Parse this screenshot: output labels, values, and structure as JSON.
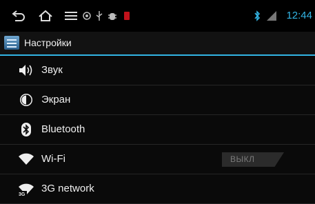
{
  "status_bar": {
    "nav_icons": [
      "back-icon",
      "home-icon",
      "recent-apps-icon"
    ],
    "notification_icons": [
      "gps-icon",
      "usb-icon",
      "debug-icon",
      "warning-icon"
    ],
    "indicators": [
      "bluetooth-icon",
      "signal-icon"
    ],
    "time": "12:44",
    "accent_color": "#33b5e5"
  },
  "header": {
    "icon": "settings-app-icon",
    "title": "Настройки"
  },
  "settings": {
    "items": [
      {
        "label": "Звук",
        "icon": "sound-icon"
      },
      {
        "label": "Экран",
        "icon": "display-icon"
      },
      {
        "label": "Bluetooth",
        "icon": "bluetooth-icon"
      },
      {
        "label": "Wi-Fi",
        "icon": "wifi-icon",
        "toggle": "ВЫКЛ"
      },
      {
        "label": "3G network",
        "icon": "3g-network-icon"
      }
    ]
  }
}
